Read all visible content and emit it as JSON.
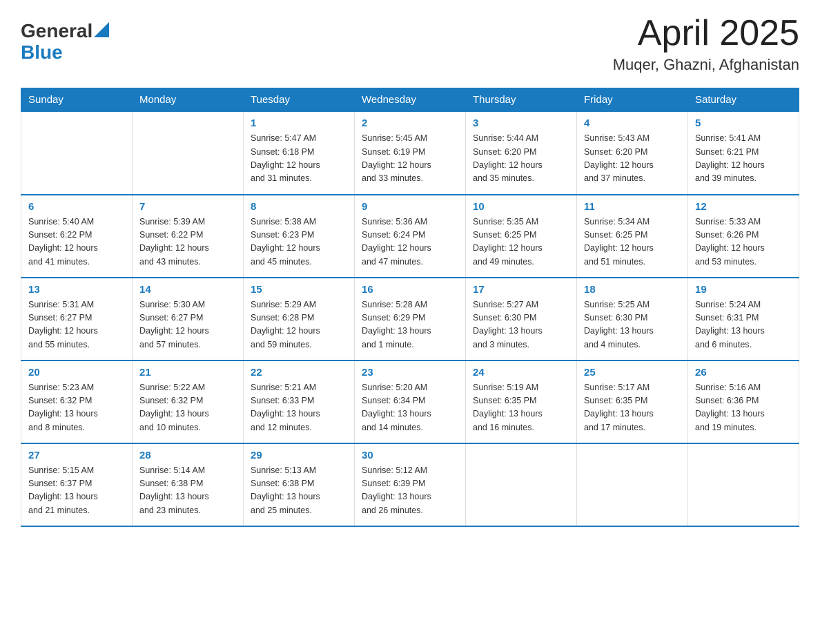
{
  "header": {
    "logo_general": "General",
    "logo_blue": "Blue",
    "month": "April 2025",
    "location": "Muqer, Ghazni, Afghanistan"
  },
  "weekdays": [
    "Sunday",
    "Monday",
    "Tuesday",
    "Wednesday",
    "Thursday",
    "Friday",
    "Saturday"
  ],
  "weeks": [
    [
      {
        "day": "",
        "info": ""
      },
      {
        "day": "",
        "info": ""
      },
      {
        "day": "1",
        "info": "Sunrise: 5:47 AM\nSunset: 6:18 PM\nDaylight: 12 hours\nand 31 minutes."
      },
      {
        "day": "2",
        "info": "Sunrise: 5:45 AM\nSunset: 6:19 PM\nDaylight: 12 hours\nand 33 minutes."
      },
      {
        "day": "3",
        "info": "Sunrise: 5:44 AM\nSunset: 6:20 PM\nDaylight: 12 hours\nand 35 minutes."
      },
      {
        "day": "4",
        "info": "Sunrise: 5:43 AM\nSunset: 6:20 PM\nDaylight: 12 hours\nand 37 minutes."
      },
      {
        "day": "5",
        "info": "Sunrise: 5:41 AM\nSunset: 6:21 PM\nDaylight: 12 hours\nand 39 minutes."
      }
    ],
    [
      {
        "day": "6",
        "info": "Sunrise: 5:40 AM\nSunset: 6:22 PM\nDaylight: 12 hours\nand 41 minutes."
      },
      {
        "day": "7",
        "info": "Sunrise: 5:39 AM\nSunset: 6:22 PM\nDaylight: 12 hours\nand 43 minutes."
      },
      {
        "day": "8",
        "info": "Sunrise: 5:38 AM\nSunset: 6:23 PM\nDaylight: 12 hours\nand 45 minutes."
      },
      {
        "day": "9",
        "info": "Sunrise: 5:36 AM\nSunset: 6:24 PM\nDaylight: 12 hours\nand 47 minutes."
      },
      {
        "day": "10",
        "info": "Sunrise: 5:35 AM\nSunset: 6:25 PM\nDaylight: 12 hours\nand 49 minutes."
      },
      {
        "day": "11",
        "info": "Sunrise: 5:34 AM\nSunset: 6:25 PM\nDaylight: 12 hours\nand 51 minutes."
      },
      {
        "day": "12",
        "info": "Sunrise: 5:33 AM\nSunset: 6:26 PM\nDaylight: 12 hours\nand 53 minutes."
      }
    ],
    [
      {
        "day": "13",
        "info": "Sunrise: 5:31 AM\nSunset: 6:27 PM\nDaylight: 12 hours\nand 55 minutes."
      },
      {
        "day": "14",
        "info": "Sunrise: 5:30 AM\nSunset: 6:27 PM\nDaylight: 12 hours\nand 57 minutes."
      },
      {
        "day": "15",
        "info": "Sunrise: 5:29 AM\nSunset: 6:28 PM\nDaylight: 12 hours\nand 59 minutes."
      },
      {
        "day": "16",
        "info": "Sunrise: 5:28 AM\nSunset: 6:29 PM\nDaylight: 13 hours\nand 1 minute."
      },
      {
        "day": "17",
        "info": "Sunrise: 5:27 AM\nSunset: 6:30 PM\nDaylight: 13 hours\nand 3 minutes."
      },
      {
        "day": "18",
        "info": "Sunrise: 5:25 AM\nSunset: 6:30 PM\nDaylight: 13 hours\nand 4 minutes."
      },
      {
        "day": "19",
        "info": "Sunrise: 5:24 AM\nSunset: 6:31 PM\nDaylight: 13 hours\nand 6 minutes."
      }
    ],
    [
      {
        "day": "20",
        "info": "Sunrise: 5:23 AM\nSunset: 6:32 PM\nDaylight: 13 hours\nand 8 minutes."
      },
      {
        "day": "21",
        "info": "Sunrise: 5:22 AM\nSunset: 6:32 PM\nDaylight: 13 hours\nand 10 minutes."
      },
      {
        "day": "22",
        "info": "Sunrise: 5:21 AM\nSunset: 6:33 PM\nDaylight: 13 hours\nand 12 minutes."
      },
      {
        "day": "23",
        "info": "Sunrise: 5:20 AM\nSunset: 6:34 PM\nDaylight: 13 hours\nand 14 minutes."
      },
      {
        "day": "24",
        "info": "Sunrise: 5:19 AM\nSunset: 6:35 PM\nDaylight: 13 hours\nand 16 minutes."
      },
      {
        "day": "25",
        "info": "Sunrise: 5:17 AM\nSunset: 6:35 PM\nDaylight: 13 hours\nand 17 minutes."
      },
      {
        "day": "26",
        "info": "Sunrise: 5:16 AM\nSunset: 6:36 PM\nDaylight: 13 hours\nand 19 minutes."
      }
    ],
    [
      {
        "day": "27",
        "info": "Sunrise: 5:15 AM\nSunset: 6:37 PM\nDaylight: 13 hours\nand 21 minutes."
      },
      {
        "day": "28",
        "info": "Sunrise: 5:14 AM\nSunset: 6:38 PM\nDaylight: 13 hours\nand 23 minutes."
      },
      {
        "day": "29",
        "info": "Sunrise: 5:13 AM\nSunset: 6:38 PM\nDaylight: 13 hours\nand 25 minutes."
      },
      {
        "day": "30",
        "info": "Sunrise: 5:12 AM\nSunset: 6:39 PM\nDaylight: 13 hours\nand 26 minutes."
      },
      {
        "day": "",
        "info": ""
      },
      {
        "day": "",
        "info": ""
      },
      {
        "day": "",
        "info": ""
      }
    ]
  ]
}
